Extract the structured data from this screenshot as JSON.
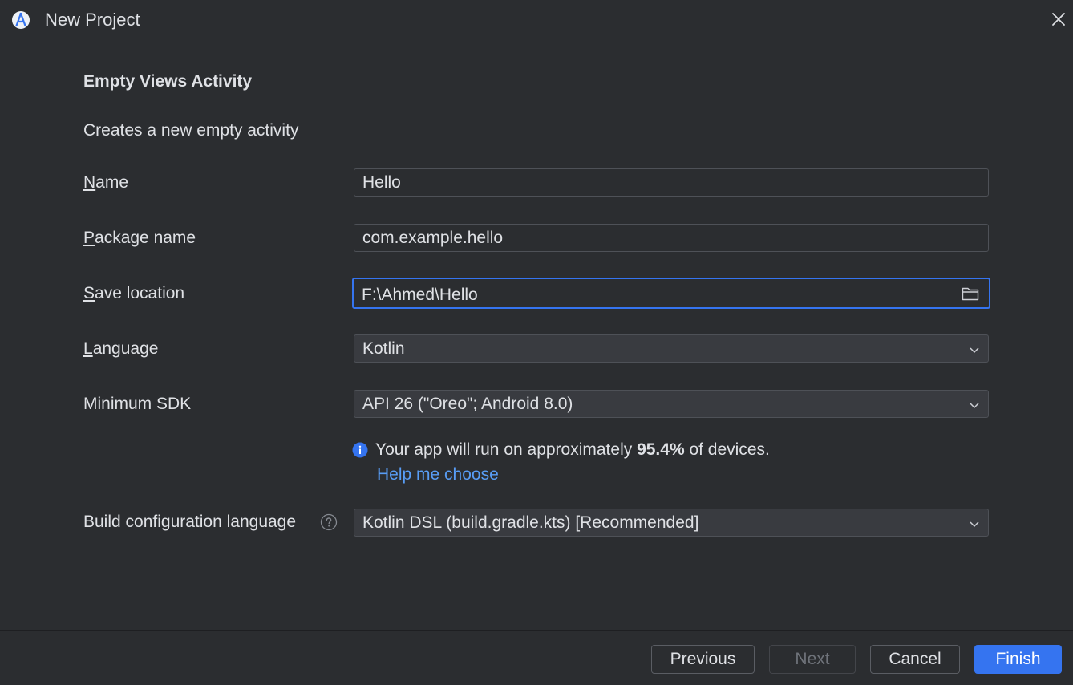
{
  "window": {
    "title": "New Project",
    "close_icon": "close-icon",
    "logo_icon": "android-studio-icon"
  },
  "template": {
    "heading": "Empty Views Activity",
    "description": "Creates a new empty activity"
  },
  "form": {
    "name": {
      "mnemonic": "N",
      "label_rest": "ame",
      "value": "Hello"
    },
    "package_name": {
      "mnemonic": "P",
      "label_rest": "ackage name",
      "value": "com.example.hello"
    },
    "save_location": {
      "mnemonic": "S",
      "label_rest": "ave location",
      "value_before_caret": "F:\\Ahmed",
      "value_after_caret": "\\Hello",
      "icon": "folder-icon"
    },
    "language": {
      "mnemonic": "L",
      "label_rest": "anguage",
      "value": "Kotlin"
    },
    "minimum_sdk": {
      "label": "Minimum SDK",
      "value": "API 26 (\"Oreo\"; Android 8.0)"
    },
    "sdk_info": {
      "prefix": "Your app will run on approximately ",
      "percent": "95.4%",
      "suffix": " of devices.",
      "link": "Help me choose"
    },
    "build_config": {
      "label": "Build configuration language",
      "value": "Kotlin DSL (build.gradle.kts) [Recommended]"
    }
  },
  "buttons": {
    "previous": "Previous",
    "next": "Next",
    "cancel": "Cancel",
    "finish": "Finish"
  },
  "colors": {
    "background": "#2b2d30",
    "accent": "#3574f0",
    "link": "#589df6"
  }
}
